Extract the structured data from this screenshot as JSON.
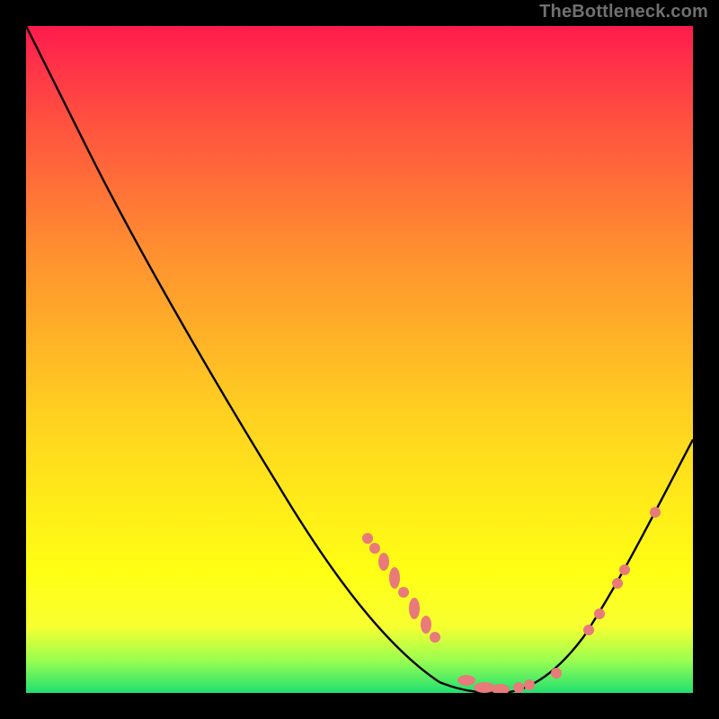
{
  "watermark": "TheBottleneck.com",
  "chart_data": {
    "type": "line",
    "title": "",
    "xlabel": "",
    "ylabel": "",
    "xlim": [
      0,
      100
    ],
    "ylim": [
      0,
      100
    ],
    "background": "rainbow-gradient-vertical",
    "series": [
      {
        "name": "bottleneck-curve",
        "type": "line",
        "color": "#000000",
        "x": [
          0,
          5,
          10,
          15,
          20,
          25,
          30,
          35,
          40,
          45,
          50,
          55,
          60,
          62,
          65,
          68,
          70,
          72,
          75,
          80,
          85,
          90,
          95,
          100
        ],
        "values": [
          99,
          97,
          92,
          85,
          77,
          68,
          59,
          50,
          41,
          32,
          24,
          16,
          8,
          5,
          2,
          0,
          0,
          0,
          2,
          8,
          18,
          30,
          41,
          50
        ]
      },
      {
        "name": "data-points",
        "type": "scatter",
        "color": "#e87a7a",
        "x": [
          45,
          46,
          49,
          50,
          52,
          53,
          55,
          56,
          63,
          65,
          67,
          68,
          70,
          71,
          73,
          80,
          82,
          85,
          86
        ],
        "values": [
          32,
          30,
          25,
          23,
          20,
          18,
          15,
          14,
          3,
          1,
          0,
          0,
          0,
          0,
          1,
          8,
          12,
          18,
          20
        ]
      }
    ],
    "curve_minimum_x": 69,
    "curve_minimum_value": 0
  },
  "colors": {
    "background": "#000000",
    "gradient_top": "#ff1a4d",
    "gradient_bottom": "#20e070",
    "curve": "#000000",
    "points": "#e87a7a",
    "watermark": "#707070"
  }
}
